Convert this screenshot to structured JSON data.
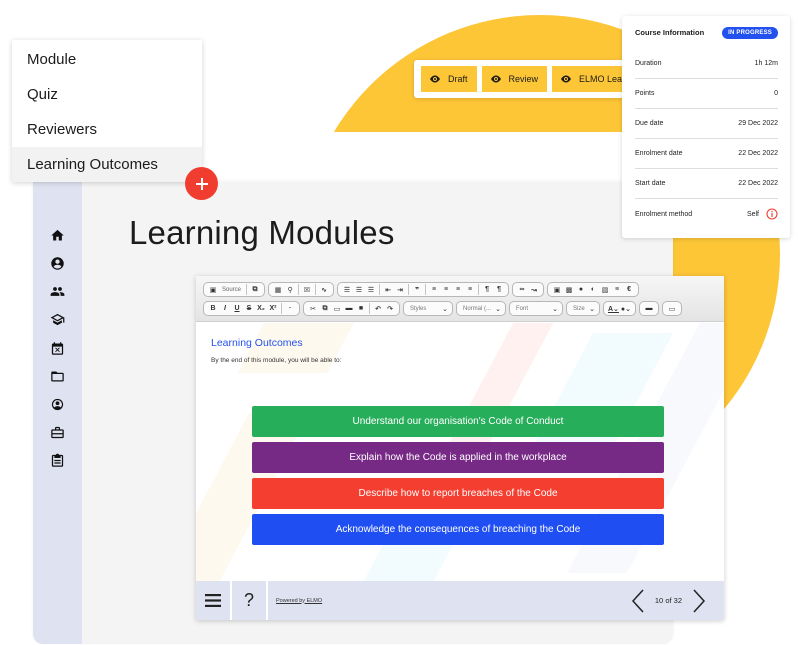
{
  "menu": {
    "items": [
      {
        "label": "Module"
      },
      {
        "label": "Quiz"
      },
      {
        "label": "Reviewers"
      },
      {
        "label": "Learning Outcomes",
        "active": true
      }
    ],
    "add_icon": "plus-icon"
  },
  "status_buttons": [
    {
      "label": "Draft",
      "icon": "eye-icon"
    },
    {
      "label": "Review",
      "icon": "eye-icon"
    },
    {
      "label": "ELMO Learning",
      "icon": "eye-icon"
    }
  ],
  "course_info": {
    "title": "Course Information",
    "status": "IN PROGRESS",
    "rows": [
      {
        "label": "Duration",
        "value": "1h 12m"
      },
      {
        "label": "Points",
        "value": "0"
      },
      {
        "label": "Due date",
        "value": "29 Dec 2022"
      },
      {
        "label": "Enrolment date",
        "value": "22 Dec 2022"
      },
      {
        "label": "Start date",
        "value": "22 Dec 2022"
      },
      {
        "label": "Enrolment method",
        "value": "Self",
        "icon": "info-icon"
      }
    ]
  },
  "sidebar": {
    "icons": [
      "home-icon",
      "account-icon",
      "users-icon",
      "graduation-cap-icon",
      "calendar-icon",
      "folder-icon",
      "user-settings-icon",
      "briefcase-icon",
      "clipboard-icon"
    ]
  },
  "page": {
    "title": "Learning Modules"
  },
  "editor": {
    "toolbar": {
      "source_label": "Source",
      "styles_label": "Styles",
      "format_label": "Normal (...",
      "font_label": "Font",
      "size_label": "Size",
      "format_buttons": [
        "B",
        "I",
        "U",
        "S",
        "X₂",
        "X²"
      ]
    },
    "content": {
      "heading": "Learning Outcomes",
      "intro": "By the end of this module, you will be able to:",
      "outcomes": [
        {
          "text": "Understand our organisation's Code of Conduct",
          "color": "#27ae5a"
        },
        {
          "text": "Explain how the Code is applied in the workplace",
          "color": "#762a85"
        },
        {
          "text": "Describe how to report breaches of the Code",
          "color": "#f43e30"
        },
        {
          "text": "Acknowledge the consequences of breaching the Code",
          "color": "#1f4ff2"
        }
      ]
    },
    "player": {
      "help_label": "?",
      "powered_by": "Powered by ELMO",
      "page_count": "10 of 32"
    }
  },
  "colors": {
    "accent_yellow": "#fdc637",
    "brand_blue": "#2351f0",
    "fab_red": "#f03d2f",
    "rail_bg": "#dfe2f0"
  }
}
